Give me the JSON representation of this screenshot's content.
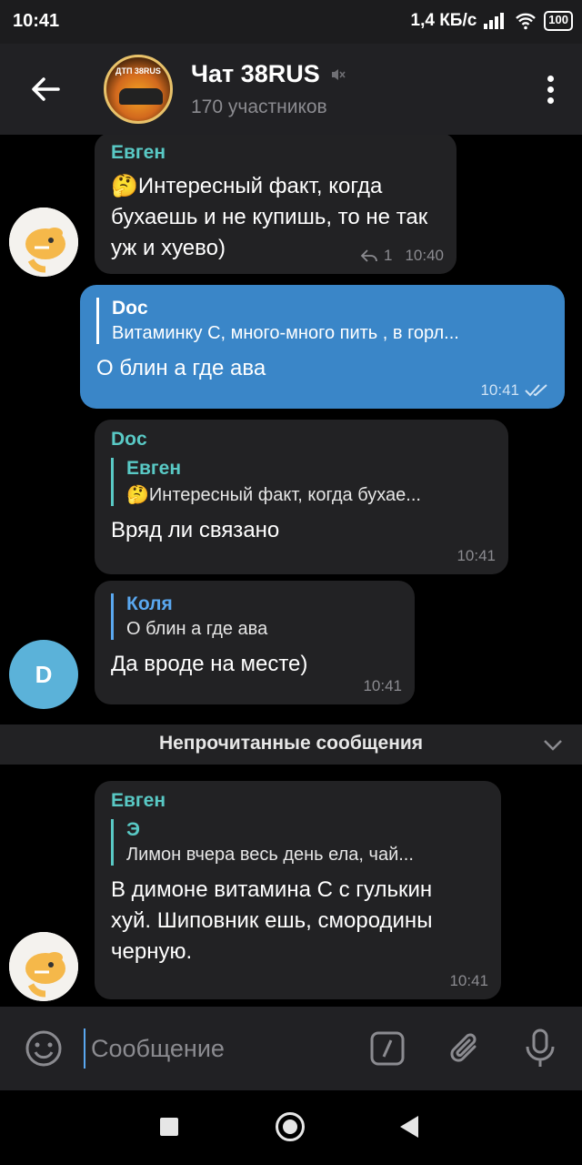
{
  "status": {
    "time": "10:41",
    "speed": "1,4 КБ/с",
    "battery": "100"
  },
  "header": {
    "title": "Чат 38RUS",
    "subtitle": "170 участников",
    "avatar_label": "ДТП 38RUS"
  },
  "messages": [
    {
      "sender": "Евген",
      "text": "🤔Интересный факт, когда бухаешь и не купишь, то не так уж и хуево)",
      "replies": "1",
      "time": "10:40"
    },
    {
      "reply_name": "Doc",
      "reply_text": "Витаминку С, много-много пить , в горл...",
      "text": "О блин а где ава",
      "time": "10:41"
    },
    {
      "sender": "Doc",
      "reply_name": "Евген",
      "reply_text": "🤔Интересный факт, когда бухае...",
      "text": "Вряд ли связано",
      "time": "10:41"
    },
    {
      "reply_name": "Коля",
      "reply_text": "О блин а где ава",
      "text": "Да вроде на месте)",
      "time": "10:41",
      "avatar_letter": "D"
    },
    {
      "sender": "Евген",
      "reply_name": "Э",
      "reply_text": "Лимон вчера весь день ела, чай...",
      "text": "В димоне витамина С с гулькин хуй. Шиповник ешь, смородины черную.",
      "time": "10:41"
    }
  ],
  "unread_label": "Непрочитанные сообщения",
  "input": {
    "placeholder": "Сообщение"
  },
  "colors": {
    "accent": "#5aa8f0",
    "sender": "#59c9c5",
    "outgoing": "#3a86c8",
    "incoming": "#222224"
  },
  "icons": [
    "back-arrow-icon",
    "mute-icon",
    "more-vert-icon",
    "reply-icon",
    "double-check-icon",
    "chevron-down-icon",
    "emoji-icon",
    "bot-command-icon",
    "attach-icon",
    "mic-icon"
  ]
}
